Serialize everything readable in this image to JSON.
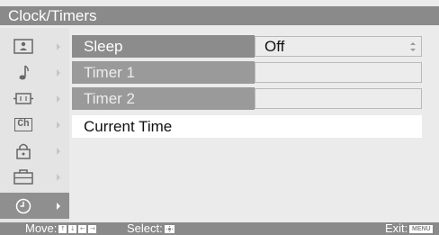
{
  "window": {
    "title": "Clock/Timers"
  },
  "sidebar": {
    "items": [
      {
        "icon": "picture-icon"
      },
      {
        "icon": "sound-note-icon"
      },
      {
        "icon": "screen-icon"
      },
      {
        "icon": "channel-icon",
        "text": "Ch"
      },
      {
        "icon": "lock-icon"
      },
      {
        "icon": "setup-icon"
      },
      {
        "icon": "clock-icon",
        "active": true
      }
    ]
  },
  "menu": {
    "rows": [
      {
        "label": "Sleep",
        "value": "Off"
      },
      {
        "label": "Timer 1",
        "value": ""
      },
      {
        "label": "Timer 2",
        "value": ""
      },
      {
        "label": "Current Time"
      }
    ]
  },
  "footer": {
    "move_label": "Move:",
    "move_keys": [
      "↑",
      "↓",
      "←",
      "→"
    ],
    "select_label": "Select:",
    "exit_label": "Exit:",
    "exit_key": "MENU"
  },
  "colors": {
    "bar": "#8a8a8a",
    "background": "#ebebeb",
    "highlight": "#ffffff"
  }
}
